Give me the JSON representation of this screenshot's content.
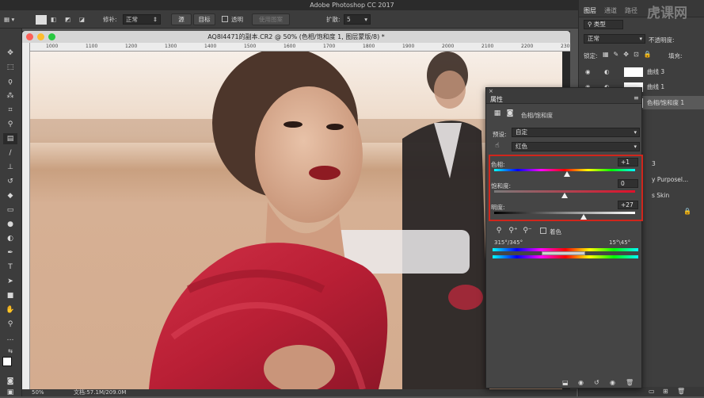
{
  "app": {
    "title": "Adobe Photoshop CC 2017"
  },
  "options_bar": {
    "feather_label": "修补:",
    "mode_value": "正常",
    "source_button": "源",
    "target_button": "目标",
    "transparent_label": "透明",
    "use_pattern_button": "使用图案",
    "diffusion_label": "扩散:",
    "diffusion_value": "5"
  },
  "document": {
    "tab_title": "AQ8I4471的副本.CR2 @ 50% (色相/饱和度 1, 图层蒙版/8) *",
    "ruler_labels": [
      "1000",
      "1100",
      "1200",
      "1300",
      "1400",
      "1500",
      "1600",
      "1700",
      "1800",
      "1900",
      "2000",
      "2100",
      "2200",
      "2300"
    ]
  },
  "status_bar": {
    "zoom": "50%",
    "doc_info": "文档:57.1M/209.0M"
  },
  "layers_panel": {
    "tabs": [
      "图层",
      "通道",
      "路径"
    ],
    "kind_filter": "类型",
    "blend_mode": "正常",
    "opacity_label": "不透明度:",
    "lock_label": "锁定:",
    "fill_label": "填充:",
    "layers": [
      {
        "name": "曲线 3"
      },
      {
        "name": "曲线 1"
      },
      {
        "name": "色相/饱和度 1"
      },
      {
        "name": "3"
      },
      {
        "name": "y Purposel..."
      },
      {
        "name": "s Skin"
      }
    ],
    "watermark": "虎课网"
  },
  "properties_panel": {
    "tab_label": "属性",
    "adjustment_name": "色相/饱和度",
    "preset_label": "预设:",
    "preset_value": "自定",
    "channel_value": "红色",
    "hue_label": "色相:",
    "hue_value": "+1",
    "saturation_label": "饱和度:",
    "saturation_value": "0",
    "lightness_label": "明度:",
    "lightness_value": "+27",
    "colorize_label": "着色",
    "range_left": "315°/345°",
    "range_right": "15°\\45°",
    "hue_level": 0.515,
    "saturation_level": 0.5,
    "lightness_level": 0.635
  },
  "colors": {
    "highlight": "#d0261c",
    "panel_bg": "#454545"
  }
}
